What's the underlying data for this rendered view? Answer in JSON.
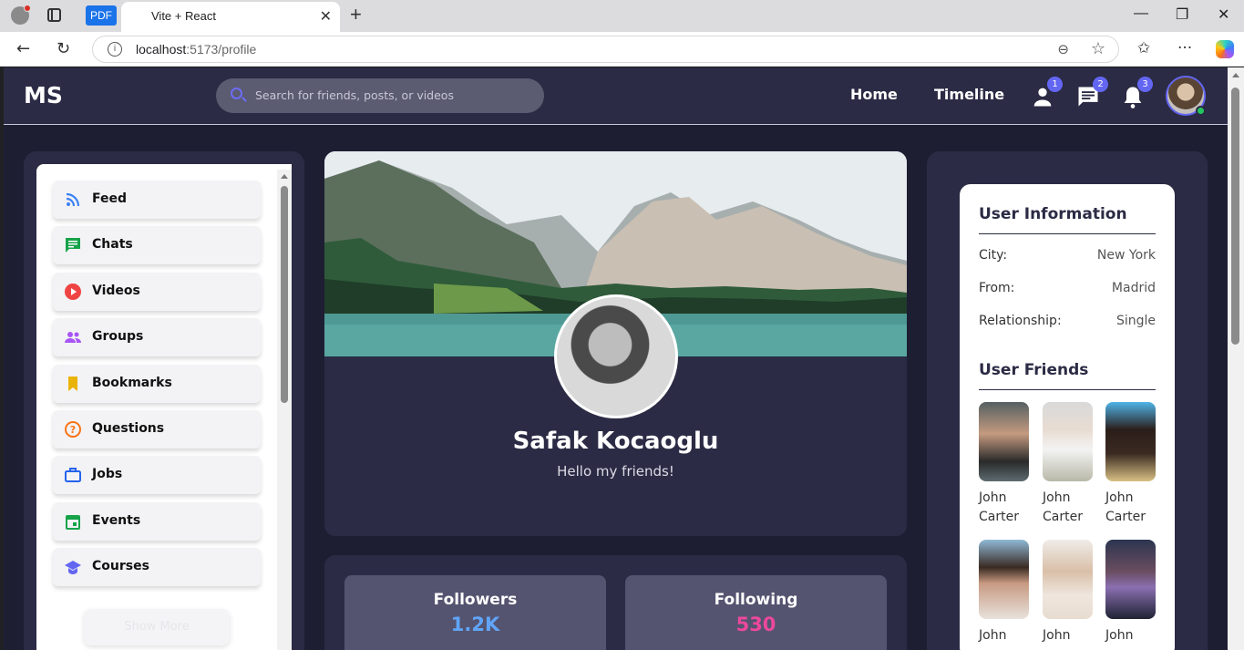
{
  "browser": {
    "pdf_label": "PDF",
    "tab_title": "Vite + React",
    "url_host": "localhost",
    "url_path": ":5173/profile"
  },
  "navbar": {
    "logo": "MS",
    "search_placeholder": "Search for friends, posts, or videos",
    "links": [
      "Home",
      "Timeline"
    ],
    "badges": {
      "friends": "1",
      "messages": "2",
      "notifications": "3"
    }
  },
  "sidebar": {
    "items": [
      {
        "label": "Feed",
        "icon": "rss-icon",
        "color": "#3b82f6"
      },
      {
        "label": "Chats",
        "icon": "chat-icon",
        "color": "#16a34a"
      },
      {
        "label": "Videos",
        "icon": "play-icon",
        "color": "#ef4444"
      },
      {
        "label": "Groups",
        "icon": "groups-icon",
        "color": "#a855f7"
      },
      {
        "label": "Bookmarks",
        "icon": "bookmark-icon",
        "color": "#eab308"
      },
      {
        "label": "Questions",
        "icon": "question-icon",
        "color": "#f97316"
      },
      {
        "label": "Jobs",
        "icon": "briefcase-icon",
        "color": "#2563eb"
      },
      {
        "label": "Events",
        "icon": "calendar-icon",
        "color": "#16a34a"
      },
      {
        "label": "Courses",
        "icon": "graduation-icon",
        "color": "#6366f1"
      }
    ],
    "show_more": "Show More"
  },
  "profile": {
    "name": "Safak Kocaoglu",
    "bio": "Hello my friends!"
  },
  "stats": {
    "followers_label": "Followers",
    "followers_value": "1.2K",
    "followers_color": "#60a5fa",
    "following_label": "Following",
    "following_value": "530",
    "following_color": "#ec4899"
  },
  "user_info": {
    "title": "User Information",
    "rows": [
      {
        "label": "City:",
        "value": "New York"
      },
      {
        "label": "From:",
        "value": "Madrid"
      },
      {
        "label": "Relationship:",
        "value": "Single"
      }
    ],
    "friends_title": "User Friends",
    "friends": [
      {
        "first": "John",
        "last": "Carter"
      },
      {
        "first": "John",
        "last": "Carter"
      },
      {
        "first": "John",
        "last": "Carter"
      },
      {
        "first": "John",
        "last": ""
      },
      {
        "first": "John",
        "last": ""
      },
      {
        "first": "John",
        "last": ""
      }
    ]
  }
}
